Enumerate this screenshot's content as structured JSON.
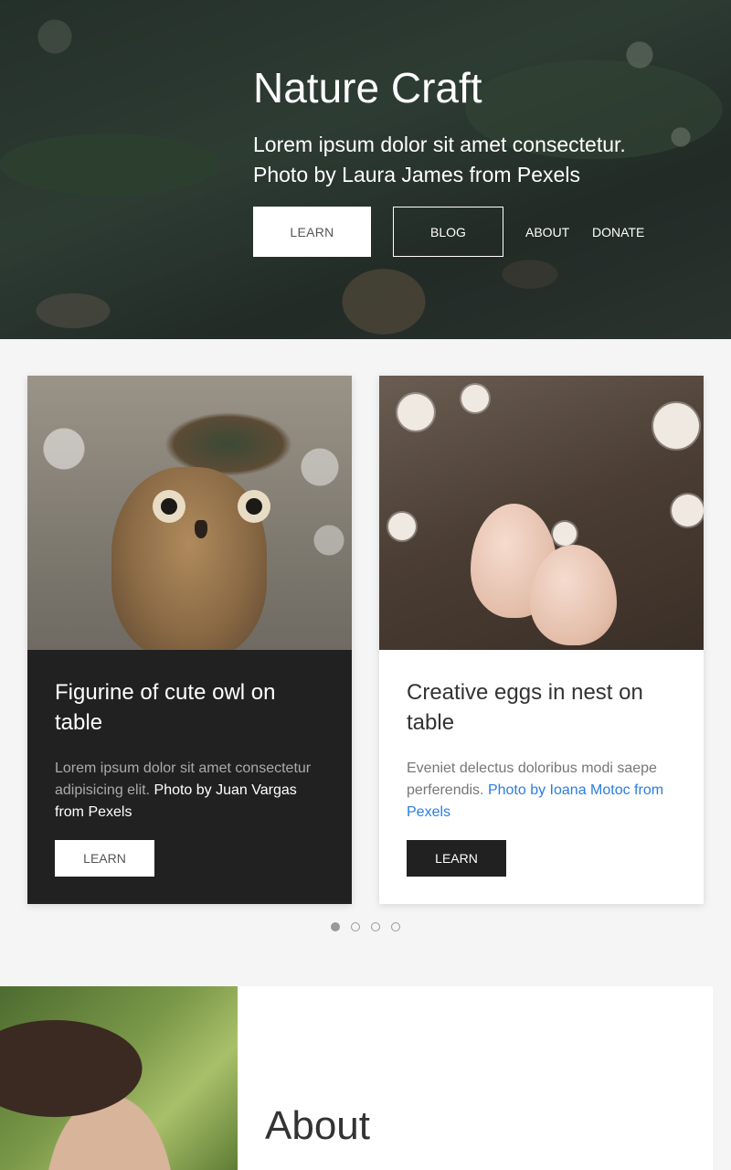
{
  "hero": {
    "title": "Nature Craft",
    "subtitle_line1": "Lorem ipsum dolor sit amet consectetur.",
    "subtitle_line2": "Photo by Laura James from Pexels",
    "buttons": {
      "learn": "LEARN",
      "blog": "BLOG",
      "about": "ABOUT",
      "donate": "DONATE"
    }
  },
  "cards": [
    {
      "title": "Figurine of cute owl on table",
      "text": "Lorem ipsum dolor sit amet consectetur adipisicing elit.",
      "credit": "Photo by Juan Vargas from Pexels",
      "button": "LEARN",
      "theme": "dark"
    },
    {
      "title": "Creative eggs in nest on table",
      "text": "Eveniet delectus doloribus modi saepe perferendis.",
      "credit": "Photo by Ioana Motoc from Pexels",
      "button": "LEARN",
      "theme": "light"
    }
  ],
  "carousel": {
    "total_slides": 4,
    "active_slide": 1
  },
  "about": {
    "title": "About"
  },
  "colors": {
    "dark_card": "#212121",
    "link_blue": "#2a7de1",
    "page_bg": "#f5f5f5"
  }
}
